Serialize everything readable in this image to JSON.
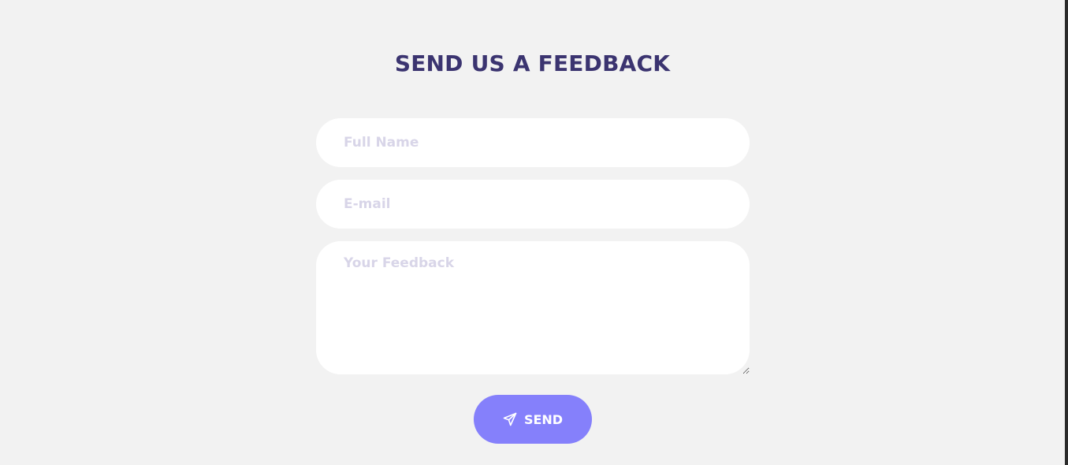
{
  "form": {
    "title": "SEND US A FEEDBACK",
    "fields": {
      "full_name": {
        "placeholder": "Full Name",
        "value": ""
      },
      "email": {
        "placeholder": "E-mail",
        "value": ""
      },
      "feedback": {
        "placeholder": "Your Feedback",
        "value": ""
      }
    },
    "send_button": {
      "label": "SEND",
      "icon": "paper-plane-icon"
    }
  },
  "colors": {
    "page_background": "#f2f2f2",
    "title": "#3b3470",
    "placeholder": "#d8d5e8",
    "field_background": "#ffffff",
    "button_background": "#8580fb",
    "button_text": "#ffffff"
  }
}
